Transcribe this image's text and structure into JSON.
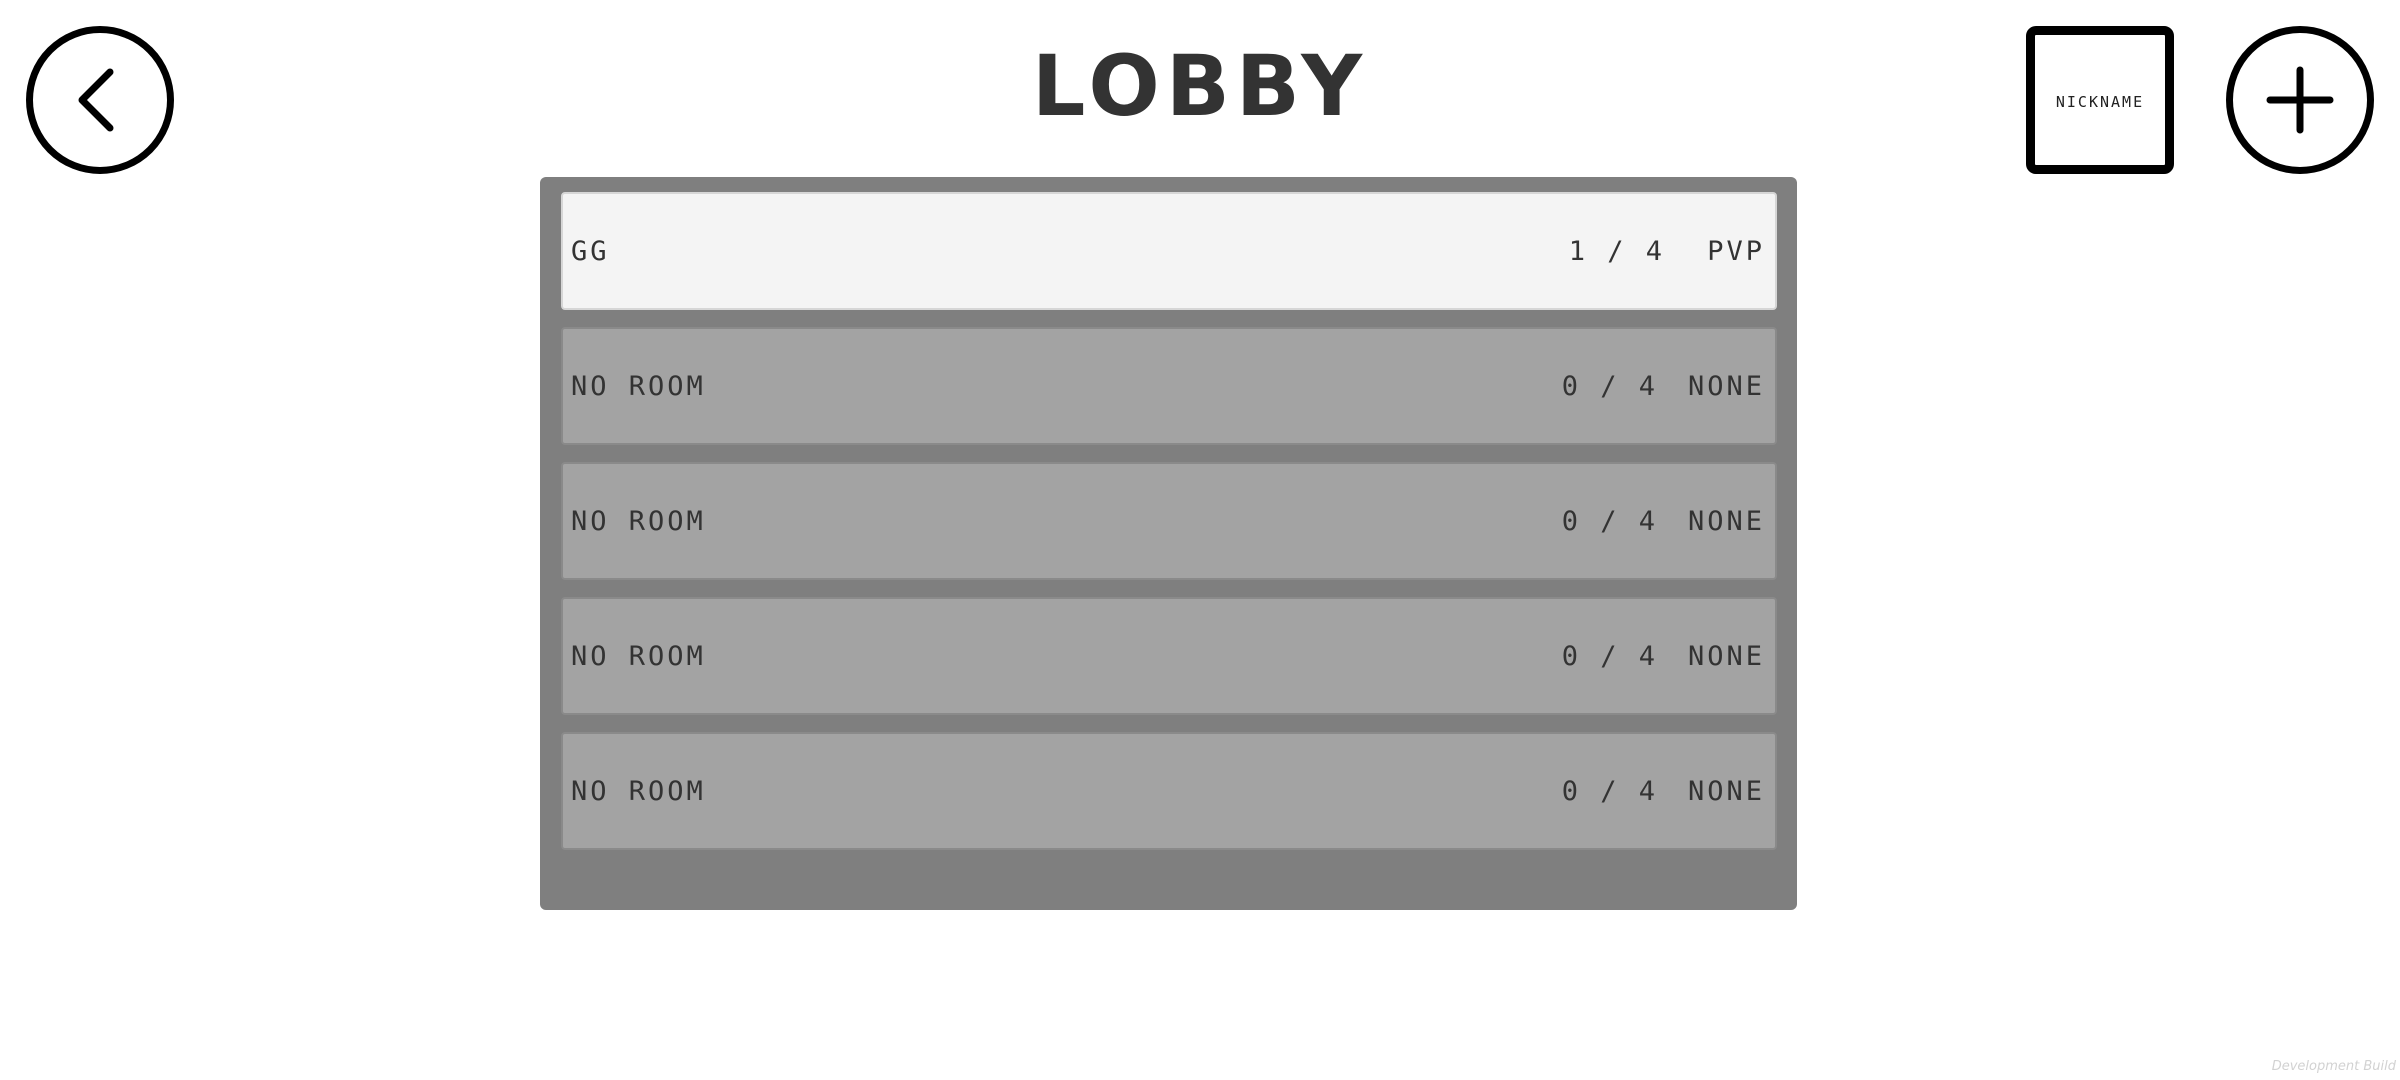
{
  "header": {
    "title": "LOBBY",
    "nickname_label": "NICKNAME"
  },
  "rooms": [
    {
      "name": "GG",
      "count": "1 / 4",
      "mode": "PVP",
      "selected": true
    },
    {
      "name": "NO ROOM",
      "count": "0 / 4",
      "mode": "NONE",
      "selected": false
    },
    {
      "name": "NO ROOM",
      "count": "0 / 4",
      "mode": "NONE",
      "selected": false
    },
    {
      "name": "NO ROOM",
      "count": "0 / 4",
      "mode": "NONE",
      "selected": false
    },
    {
      "name": "NO ROOM",
      "count": "0 / 4",
      "mode": "NONE",
      "selected": false
    }
  ],
  "footer": {
    "build_label": "Development Build"
  },
  "colors": {
    "panel": "#7f7f7f",
    "row": "#a3a3a3",
    "row_selected": "#f4f4f4",
    "text": "#333333"
  }
}
